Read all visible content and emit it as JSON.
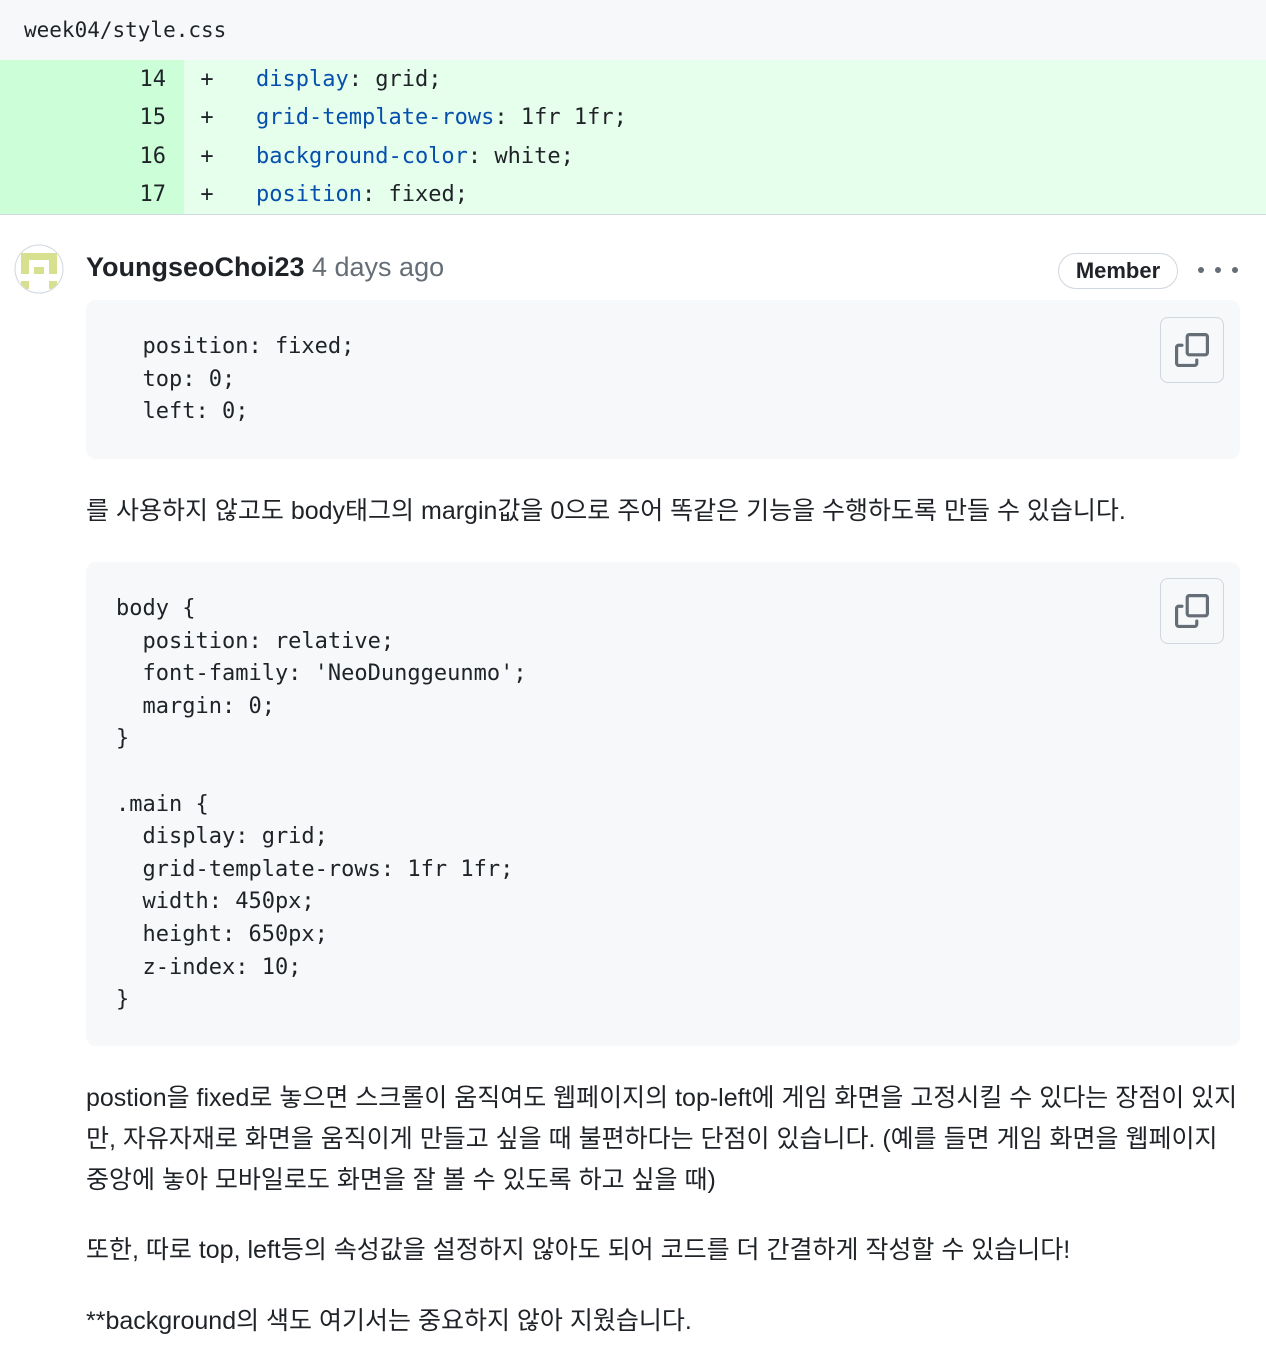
{
  "file": {
    "path": "week04/style.css"
  },
  "diff": {
    "lines": [
      {
        "num": "14",
        "sign": "+",
        "prop": "display",
        "value": " grid;"
      },
      {
        "num": "15",
        "sign": "+",
        "prop": "grid-template-rows",
        "value": " 1fr 1fr;"
      },
      {
        "num": "16",
        "sign": "+",
        "prop": "background-color",
        "value": " white;"
      },
      {
        "num": "17",
        "sign": "+",
        "prop": "position",
        "value": " fixed;"
      }
    ]
  },
  "comment": {
    "author": "YoungseoChoi23",
    "time": "4 days ago",
    "badge": "Member",
    "code1": "  position: fixed;\n  top: 0;\n  left: 0;",
    "para1": "를 사용하지 않고도 body태그의 margin값을 0으로 주어 똑같은 기능을 수행하도록 만들 수 있습니다.",
    "code2": "body {\n  position: relative;\n  font-family: 'NeoDunggeunmo';\n  margin: 0;\n}\n\n.main {\n  display: grid;\n  grid-template-rows: 1fr 1fr;\n  width: 450px;\n  height: 650px;\n  z-index: 10;\n}",
    "para2": "postion을 fixed로 놓으면 스크롤이 움직여도 웹페이지의 top-left에 게임 화면을 고정시킬 수 있다는 장점이 있지만, 자유자재로 화면을 움직이게 만들고 싶을 때 불편하다는 단점이 있습니다. (예를 들면 게임 화면을 웹페이지 중앙에 놓아 모바일로도 화면을 잘 볼 수 있도록 하고 싶을 때)",
    "para3": "또한, 따로 top, left등의 속성값을 설정하지 않아도 되어 코드를 더 간결하게 작성할 수 있습니다!",
    "para4": "**background의 색도 여기서는 중요하지 않아 지웠습니다."
  },
  "icons": {
    "copy": "copy-icon",
    "more": "kebab-horizontal-icon",
    "avatar": "identicon-avatar"
  },
  "colors": {
    "diff_add_bg": "#e6ffec",
    "diff_num_bg": "#ccffd8",
    "keyword": "#0550ae",
    "muted": "#656d76"
  }
}
